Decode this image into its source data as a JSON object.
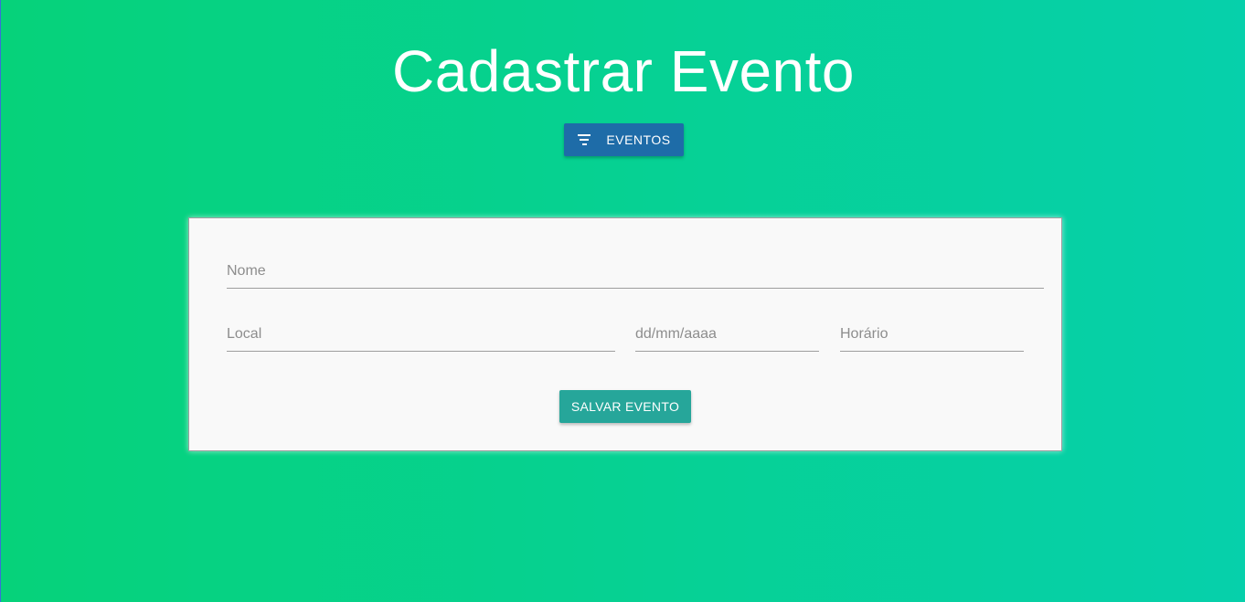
{
  "page": {
    "title": "Cadastrar Evento"
  },
  "nav": {
    "events_button_label": "EVENTOS",
    "events_button_icon": "filter-icon"
  },
  "form": {
    "name_placeholder": "Nome",
    "local_placeholder": "Local",
    "date_placeholder": "dd/mm/aaaa",
    "time_placeholder": "Horário",
    "submit_label": "SALVAR EVENTO"
  },
  "colors": {
    "background_start": "#06d27a",
    "background_end": "#06d0ab",
    "events_button": "#1e6ca8",
    "save_button": "#26a69a",
    "card": "#f9f9f9"
  }
}
